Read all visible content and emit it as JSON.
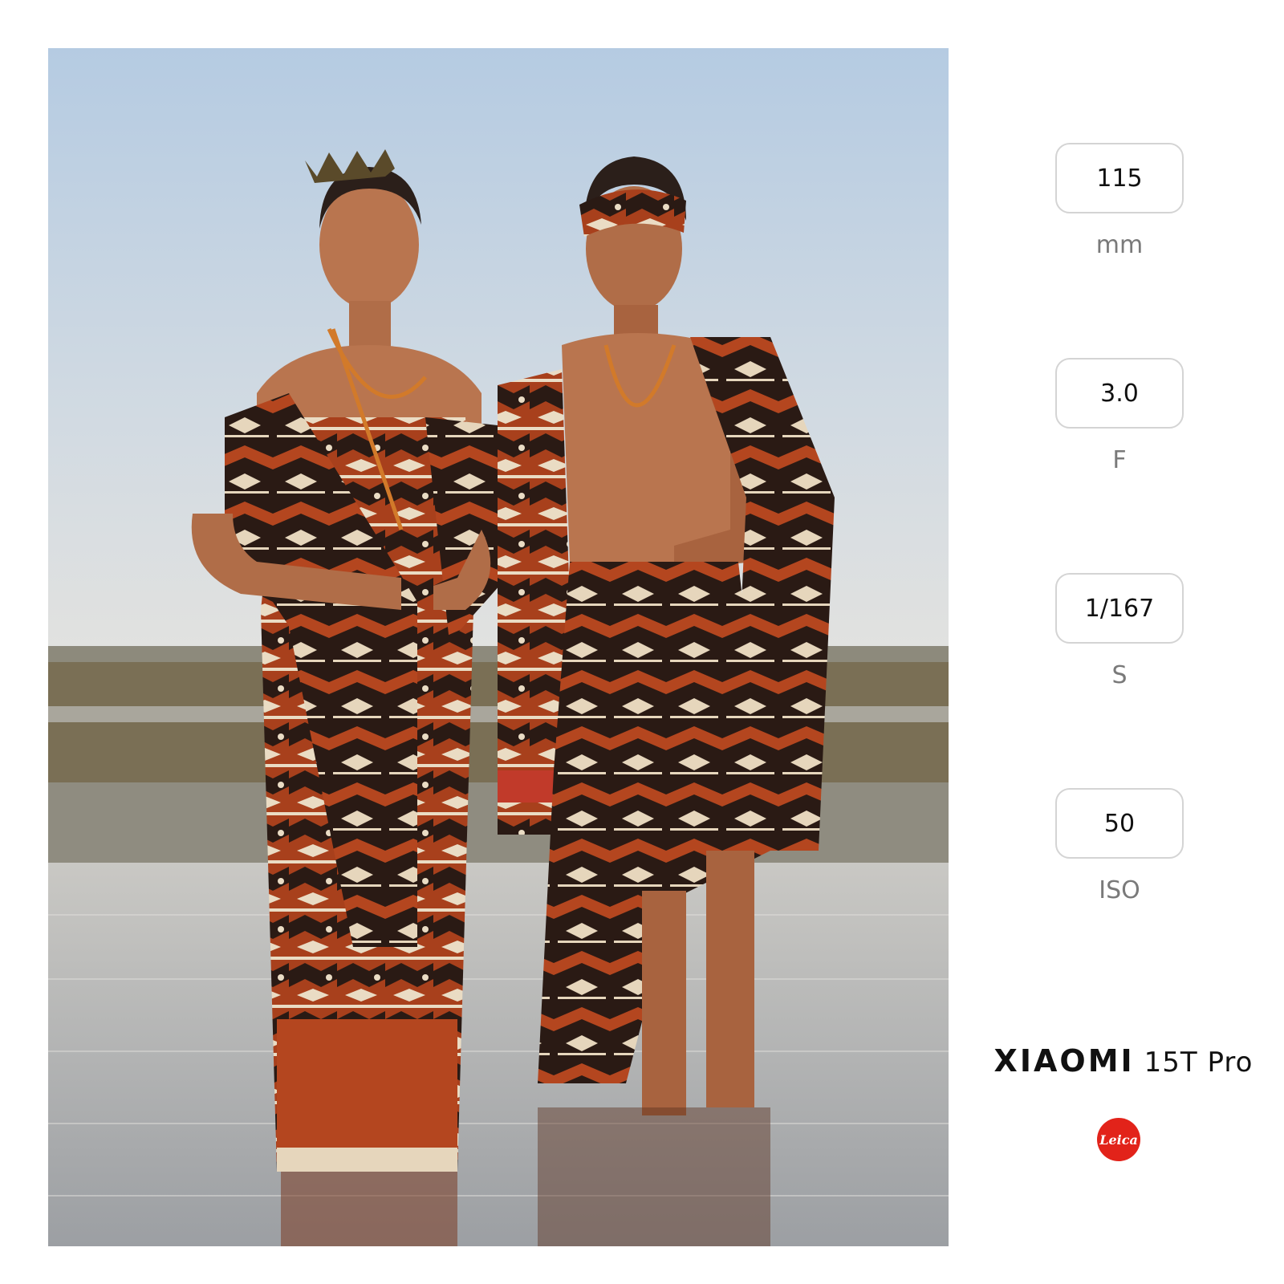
{
  "photo": {
    "description_icon": "photo-couple-in-ikat-on-tidal-flat"
  },
  "exif": {
    "focal_length": {
      "value": "115",
      "unit": "mm"
    },
    "aperture": {
      "value": "3.0",
      "unit": "F"
    },
    "shutter": {
      "value": "1/167",
      "unit": "S"
    },
    "iso": {
      "value": "50",
      "unit": "ISO"
    }
  },
  "brand": {
    "name": "XIAOMI",
    "model": "15T Pro",
    "logo_icon": "leica-icon",
    "logo_text": "Leica",
    "logo_color": "#e2231a"
  },
  "colors": {
    "sky_top": "#b7cde4",
    "sky_bottom": "#dfe3e4",
    "water": "#b8b8b8",
    "ikat_rust": "#b4461f",
    "ikat_dark": "#2a1a14",
    "ikat_cream": "#eadcc4",
    "skin": "#b9754f"
  }
}
